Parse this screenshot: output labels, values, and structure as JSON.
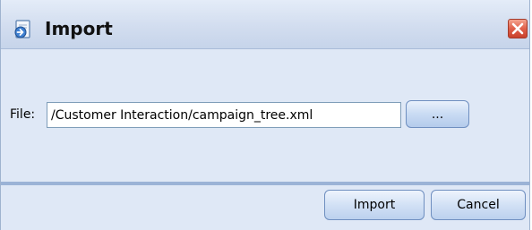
{
  "dialog": {
    "title": "Import",
    "icon": "import-icon",
    "close_icon": "close-icon"
  },
  "file": {
    "label": "File:",
    "value": "/Customer Interaction/campaign_tree.xml",
    "browse_label": "..."
  },
  "footer": {
    "import_label": "Import",
    "cancel_label": "Cancel"
  },
  "colors": {
    "dialog_background": "#dfe8f6",
    "separator": "#9bb3d6",
    "close_button": "#d9543e"
  }
}
